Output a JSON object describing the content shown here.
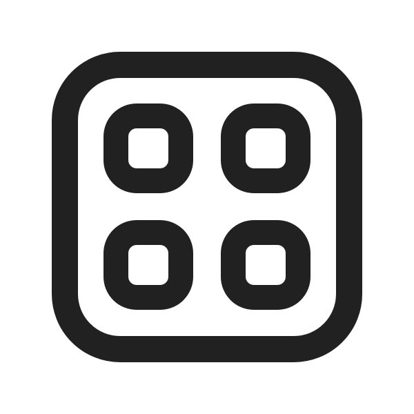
{
  "icon": {
    "name": "grid-apps-icon",
    "color": "#212121",
    "background": "#ffffff"
  }
}
